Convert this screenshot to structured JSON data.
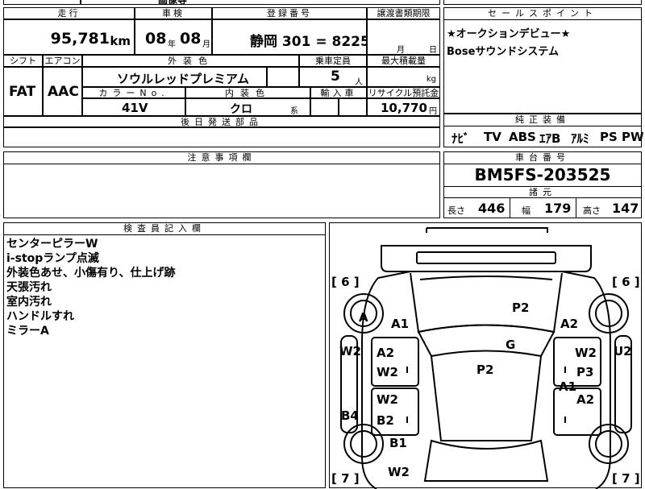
{
  "top_row_fragment": "画像等",
  "mileage": {
    "label": "走行",
    "value": "95,781",
    "unit": "km"
  },
  "inspection": {
    "label": "車検",
    "year": "08",
    "year_unit": "年",
    "month": "08",
    "month_unit": "月"
  },
  "registration": {
    "label": "登録番号",
    "value": "静岡 301 = 8225"
  },
  "transfer": {
    "label": "譲渡書類期限",
    "month_unit": "月",
    "day_unit": "日"
  },
  "sales_point": {
    "label": "セールスポイント",
    "lines": [
      "★オークションデビュー★",
      "Boseサウンドシステム"
    ]
  },
  "shift": {
    "label": "シフト",
    "value": "FAT"
  },
  "aircon": {
    "label": "エアコン",
    "value": "AAC"
  },
  "exterior_color": {
    "label": "外装色",
    "value": "ソウルレッドプレミアム"
  },
  "capacity": {
    "label": "乗車定員",
    "value": "5",
    "unit": "人"
  },
  "max_load": {
    "label": "最大積載量",
    "unit": "kg"
  },
  "color_no": {
    "label": "カラーNo.",
    "value": "41V"
  },
  "interior_color": {
    "label": "内装色",
    "value": "クロ",
    "unit": "系"
  },
  "import": {
    "label": "輸入車"
  },
  "recycle": {
    "label": "リサイクル預託金",
    "value": "10,770",
    "unit": "円"
  },
  "later_parts": {
    "label": "後日発送部品"
  },
  "equipment": {
    "label": "純正装備",
    "items": [
      "ﾅﾋﾞ",
      "TV",
      "ABS",
      "ｴｱB",
      "ｱﾙﾐ",
      "PS",
      "PW"
    ]
  },
  "notes": {
    "label": "注意事項欄"
  },
  "chassis": {
    "label": "車台番号",
    "value": "BM5FS-203525"
  },
  "specs": {
    "label": "諸元",
    "length_label": "長さ",
    "length": "446",
    "width_label": "幅",
    "width": "179",
    "height_label": "高さ",
    "height": "147"
  },
  "inspector": {
    "label": "検査員記入欄",
    "lines": [
      "センターピラーW",
      "i-stopランプ点滅",
      "外装色あせ、小傷有り、仕上げ跡",
      "天張汚れ",
      "室内汚れ",
      "ハンドルすれ",
      "ミラーA"
    ]
  },
  "diagram": {
    "tire_tl": "[ 6 ]",
    "tire_tr": "[ 6 ]",
    "tire_bl": "[ 7 ]",
    "tire_br": "[ 7 ]",
    "marks": {
      "a": "A",
      "a1_front_left": "A1",
      "p2_hood": "P2",
      "a2_front_right": "A2",
      "w2_left_side": "W2",
      "a2_left_door": "A2",
      "w2_left_door": "W2",
      "g_windshield": "G",
      "w2_right_door": "W2",
      "u2_right": "U2",
      "p2_roof": "P2",
      "p3": "P3",
      "a1_right": "A1",
      "a2_right_rear": "A2",
      "w2_left_rear": "W2",
      "b4": "B4",
      "b2": "B2",
      "b1": "B1",
      "w2_bottom": "W2"
    }
  }
}
